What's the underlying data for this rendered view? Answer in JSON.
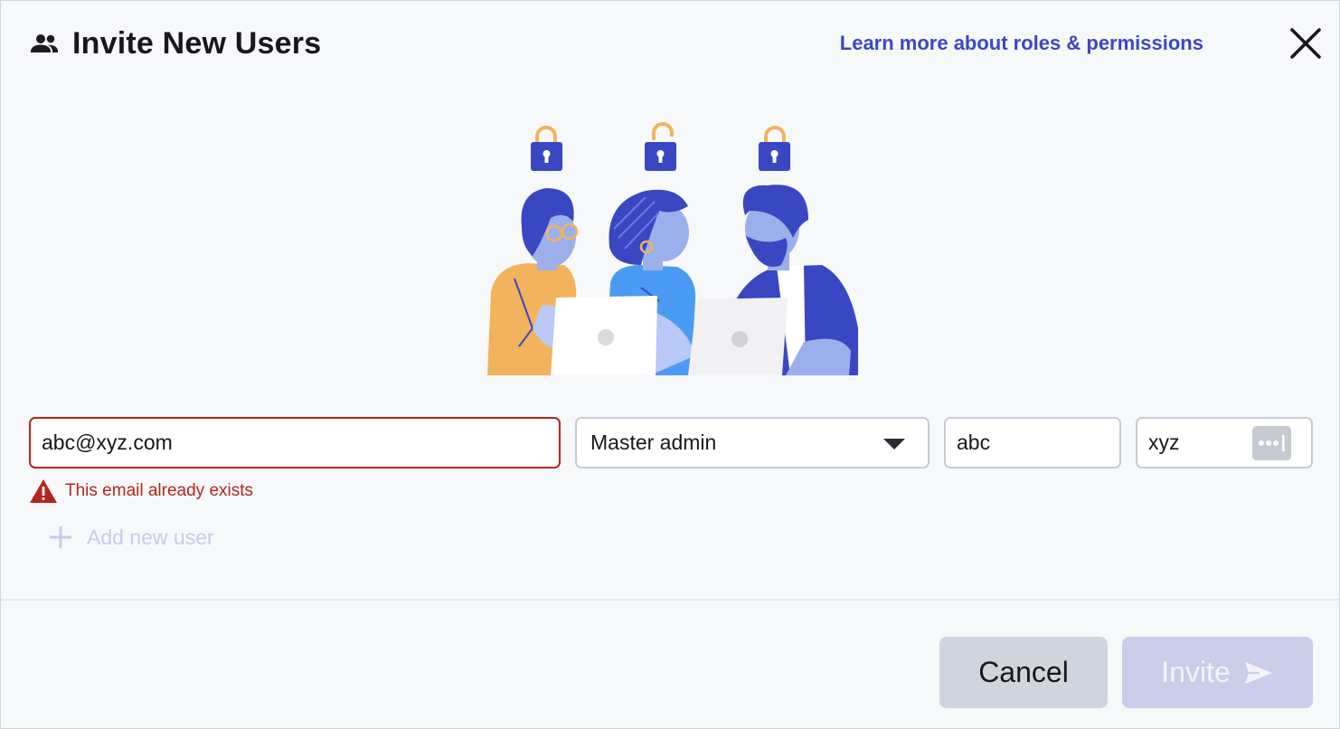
{
  "header": {
    "title": "Invite New Users",
    "title_icon": "group-icon",
    "learn_link": "Learn more about roles & permissions",
    "close_icon": "close-icon"
  },
  "illustration": {
    "description_icon": "team-illustration"
  },
  "form": {
    "email": {
      "value": "abc@xyz.com",
      "error": true
    },
    "role": {
      "selected": "Master admin",
      "icon": "chevron-down-icon"
    },
    "first_name": {
      "value": "abc"
    },
    "last_name": {
      "value": "xyz",
      "icon": "password-dots-icon"
    },
    "error_message": "This email already exists",
    "error_icon": "warning-icon",
    "add_user_label": "Add new user",
    "add_user_icon": "plus-icon"
  },
  "footer": {
    "cancel_label": "Cancel",
    "invite_label": "Invite",
    "invite_icon": "send-icon"
  },
  "colors": {
    "accent": "#3b47c4",
    "error": "#b3261e",
    "invite_disabled_bg": "#cbceea",
    "cancel_bg": "#d0d4dc"
  }
}
